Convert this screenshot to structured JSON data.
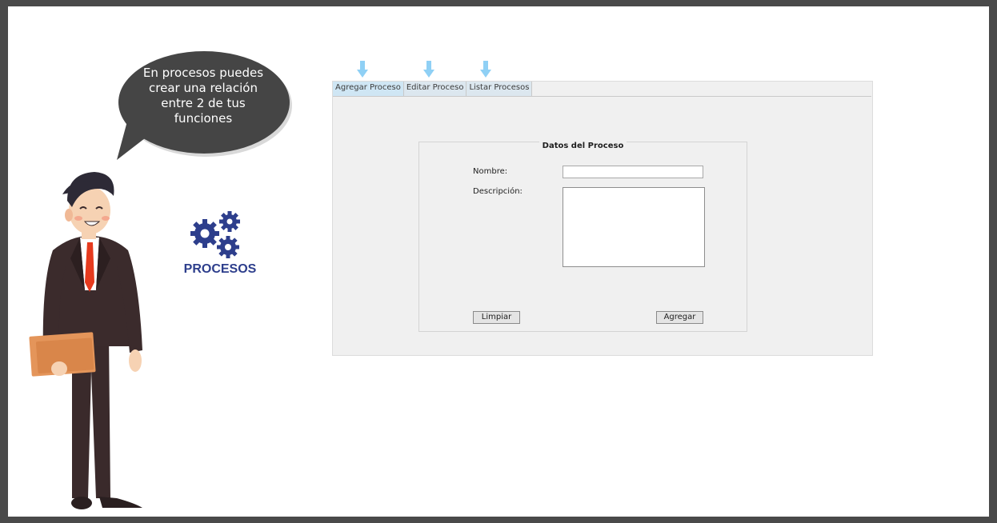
{
  "bubble": {
    "lines": [
      "En procesos puedes",
      "crear una relación",
      "entre 2 de tus",
      "funciones"
    ]
  },
  "sidebar_icon": {
    "icon": "gears-icon",
    "label": "PROCESOS",
    "color": "#2d3e8c"
  },
  "arrows": {
    "icon": "down-arrow-icon",
    "color": "#8fd0f5"
  },
  "tabs": [
    {
      "label": "Agregar Proceso",
      "active": true
    },
    {
      "label": "Editar Proceso",
      "active": false
    },
    {
      "label": "Listar Procesos",
      "active": false
    }
  ],
  "form": {
    "legend": "Datos del Proceso",
    "nombre_label": "Nombre:",
    "nombre_value": "",
    "descripcion_label": "Descripción:",
    "descripcion_value": "",
    "limpiar_button": "Limpiar",
    "agregar_button": "Agregar"
  }
}
